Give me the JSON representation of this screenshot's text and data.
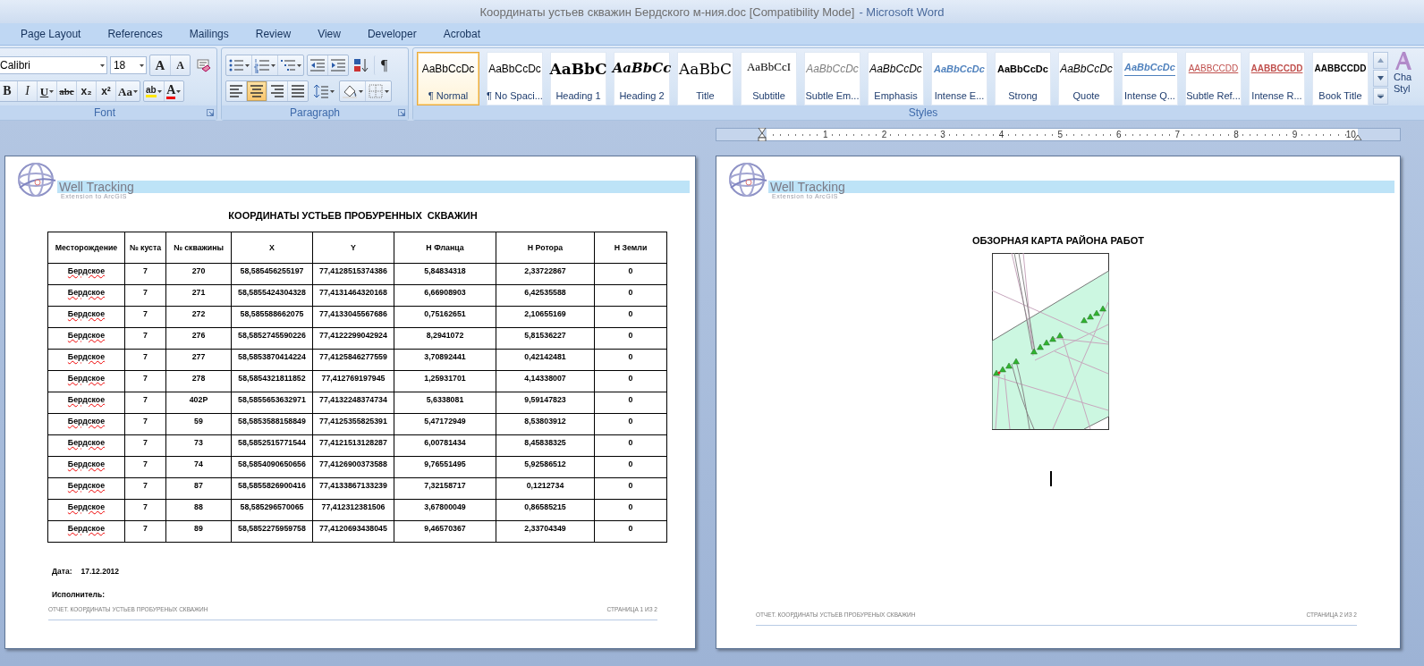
{
  "window": {
    "title": "Координаты устьев скважин Бердского м-ния.doc [Compatibility Mode]",
    "app": "- Microsoft Word"
  },
  "tabs": [
    {
      "label": "Page Layout",
      "selected": false
    },
    {
      "label": "References",
      "selected": false
    },
    {
      "label": "Mailings",
      "selected": false
    },
    {
      "label": "Review",
      "selected": false
    },
    {
      "label": "View",
      "selected": false
    },
    {
      "label": "Developer",
      "selected": false
    },
    {
      "label": "Acrobat",
      "selected": false
    }
  ],
  "font_group": {
    "label": "Font",
    "font_name": "Calibri",
    "font_size": "18",
    "row1": [
      {
        "kind": "grow",
        "label": "A",
        "selected": false
      },
      {
        "kind": "shrink",
        "label": "A",
        "selected": false
      },
      {
        "kind": "clear",
        "selected": false
      }
    ],
    "row2": [
      {
        "kind": "bold",
        "label": "B",
        "selected": false
      },
      {
        "kind": "italic",
        "label": "I",
        "selected": false
      },
      {
        "kind": "underline",
        "label": "U",
        "dropdown": true,
        "selected": false
      },
      {
        "kind": "strike",
        "label": "abc",
        "selected": false
      },
      {
        "kind": "subscript",
        "label": "x₂",
        "selected": false
      },
      {
        "kind": "superscript",
        "label": "x²",
        "selected": false
      },
      {
        "kind": "case",
        "label": "Aa",
        "dropdown": true,
        "selected": false
      },
      {
        "kind": "highlight",
        "label": "ab",
        "dropdown": true,
        "selected": false
      },
      {
        "kind": "font_color",
        "label": "A",
        "dropdown": true,
        "selected": false
      }
    ]
  },
  "paragraph_group": {
    "label": "Paragraph",
    "row1": [
      {
        "kind": "bullets",
        "dropdown": true,
        "selected": false
      },
      {
        "kind": "numbering",
        "dropdown": true,
        "selected": false
      },
      {
        "kind": "multilevel",
        "dropdown": true,
        "selected": false
      },
      {
        "kind": "outdent",
        "selected": false
      },
      {
        "kind": "indent",
        "selected": false
      },
      {
        "kind": "sort",
        "selected": false
      },
      {
        "kind": "marks",
        "label": "¶",
        "selected": false
      }
    ],
    "row2": [
      {
        "kind": "align_left",
        "selected": false
      },
      {
        "kind": "align_center",
        "selected": true
      },
      {
        "kind": "align_right",
        "selected": false
      },
      {
        "kind": "justify",
        "selected": false
      },
      {
        "kind": "line_spacing",
        "dropdown": true,
        "selected": false
      },
      {
        "kind": "shading",
        "dropdown": true,
        "selected": false
      },
      {
        "kind": "borders",
        "dropdown": true,
        "selected": false
      }
    ]
  },
  "styles_group": {
    "label": "Styles",
    "items": [
      {
        "preview": "AaBbCcDc",
        "name": "¶ Normal",
        "kind": "normal",
        "selected": true
      },
      {
        "preview": "AaBbCcDc",
        "name": "¶ No Spaci...",
        "kind": "plain",
        "selected": false
      },
      {
        "preview": "AaBbC",
        "name": "Heading 1",
        "kind": "heading1",
        "selected": false
      },
      {
        "preview": "AaBbCc",
        "name": "Heading 2",
        "kind": "heading2",
        "selected": false
      },
      {
        "preview": "AaBbC",
        "name": "Title",
        "kind": "title",
        "selected": false
      },
      {
        "preview": "AaBbCcI",
        "name": "Subtitle",
        "kind": "subtitle",
        "selected": false
      },
      {
        "preview": "AaBbCcDc",
        "name": "Subtle Em...",
        "kind": "subtle_emphasis",
        "selected": false
      },
      {
        "preview": "AaBbCcDc",
        "name": "Emphasis",
        "kind": "emphasis",
        "selected": false
      },
      {
        "preview": "AaBbCcDc",
        "name": "Intense E...",
        "kind": "intense_emphasis",
        "selected": false
      },
      {
        "preview": "AaBbCcDc",
        "name": "Strong",
        "kind": "strong",
        "selected": false
      },
      {
        "preview": "AaBbCcDc",
        "name": "Quote",
        "kind": "quote",
        "selected": false
      },
      {
        "preview": "AaBbCcDc",
        "name": "Intense Q...",
        "kind": "intense_quote",
        "selected": false
      },
      {
        "preview": "AABBCCDD",
        "name": "Subtle Ref...",
        "kind": "subtle_reference",
        "selected": false
      },
      {
        "preview": "AABBCCDD",
        "name": "Intense R...",
        "kind": "intense_reference",
        "selected": false
      },
      {
        "preview": "AABBCCDD",
        "name": "Book Title",
        "kind": "book_title",
        "selected": false
      }
    ],
    "change_styles": [
      "Cha",
      "Styl"
    ]
  },
  "ruler": {
    "labels": [
      "1",
      "2",
      "3",
      "4",
      "5",
      "6",
      "7",
      "8",
      "9",
      "10"
    ]
  },
  "pages": [
    {
      "kind": "table",
      "logo": {
        "name": "Well Tracking",
        "tagline": "Extension to ArcGIS"
      },
      "heading": "КООРДИНАТЫ УСТЬЕВ ПРОБУРЕННЫХ  СКВАЖИН",
      "table": {
        "columns": [
          "Месторождение",
          "№ куста",
          "№ скважины",
          "X",
          "Y",
          "H Фланца",
          "H Ротора",
          "H Земли"
        ],
        "rows": [
          {
            "spell_error": true,
            "cells": [
              "Бердское",
              "7",
              "270",
              "58,585456255197",
              "77,4128515374386",
              "5,84834318",
              "2,33722867",
              "0"
            ]
          },
          {
            "spell_error": true,
            "cells": [
              "Бердское",
              "7",
              "271",
              "58,5855424304328",
              "77,4131464320168",
              "6,66908903",
              "6,42535588",
              "0"
            ]
          },
          {
            "spell_error": true,
            "cells": [
              "Бердское",
              "7",
              "272",
              "58,585588662075",
              "77,4133045567686",
              "0,75162651",
              "2,10655169",
              "0"
            ]
          },
          {
            "spell_error": true,
            "cells": [
              "Бердское",
              "7",
              "276",
              "58,5852745590226",
              "77,4122299042924",
              "8,2941072",
              "5,81536227",
              "0"
            ]
          },
          {
            "spell_error": true,
            "cells": [
              "Бердское",
              "7",
              "277",
              "58,5853870414224",
              "77,4125846277559",
              "3,70892441",
              "0,42142481",
              "0"
            ]
          },
          {
            "spell_error": true,
            "cells": [
              "Бердское",
              "7",
              "278",
              "58,5854321811852",
              "77,412769197945",
              "1,25931701",
              "4,14338007",
              "0"
            ]
          },
          {
            "spell_error": true,
            "cells": [
              "Бердское",
              "7",
              "402P",
              "58,5855653632971",
              "77,4132248374734",
              "5,6338081",
              "9,59147823",
              "0"
            ]
          },
          {
            "spell_error": true,
            "cells": [
              "Бердское",
              "7",
              "59",
              "58,5853588158849",
              "77,4125355825391",
              "5,47172949",
              "8,53803912",
              "0"
            ]
          },
          {
            "spell_error": true,
            "cells": [
              "Бердское",
              "7",
              "73",
              "58,5852515771544",
              "77,4121513128287",
              "6,00781434",
              "8,45838325",
              "0"
            ]
          },
          {
            "spell_error": true,
            "cells": [
              "Бердское",
              "7",
              "74",
              "58,5854090650656",
              "77,4126900373588",
              "9,76551495",
              "5,92586512",
              "0"
            ]
          },
          {
            "spell_error": true,
            "cells": [
              "Бердское",
              "7",
              "87",
              "58,5855826900416",
              "77,4133867133239",
              "7,32158717",
              "0,1212734",
              "0"
            ]
          },
          {
            "spell_error": true,
            "cells": [
              "Бердское",
              "7",
              "88",
              "58,585296570065",
              "77,412312381506",
              "3,67800049",
              "0,86585215",
              "0"
            ]
          },
          {
            "spell_error": true,
            "cells": [
              "Бердское",
              "7",
              "89",
              "58,5852275959758",
              "77,4120693438045",
              "9,46570367",
              "2,33704349",
              "0"
            ]
          }
        ]
      },
      "date_label": "Дата:",
      "date": "17.12.2012",
      "performer_label": "Исполнитель:",
      "footer": {
        "left": "ОТЧЕТ. КООРДИНАТЫ УСТЬЕВ ПРОБУРЕНЫХ СКВАЖИН",
        "right": "СТРАНИЦА 1 ИЗ 2"
      }
    },
    {
      "kind": "map",
      "logo": {
        "name": "Well Tracking",
        "tagline": "Extension to ArcGIS"
      },
      "heading": "ОБЗОРНАЯ КАРТА РАЙОНА РАБОТ",
      "footer": {
        "left": "ОТЧЕТ. КООРДИНАТЫ УСТЬЕВ ПРОБУРЕНЫХ СКВАЖИН",
        "right": "СТРАНИЦА 2 ИЗ 2"
      }
    }
  ]
}
